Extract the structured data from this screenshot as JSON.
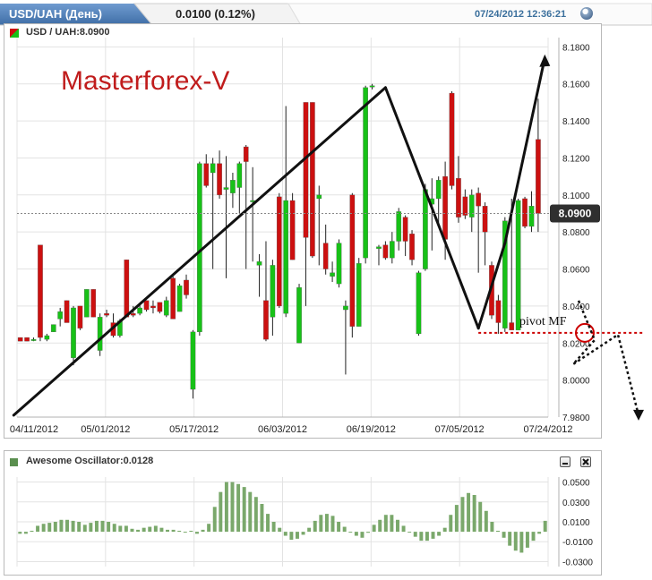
{
  "header": {
    "title": "USD/UAH (День)",
    "change": "0.0100 (0.12%)",
    "timestamp": "07/24/2012 12:36:21"
  },
  "price_panel": {
    "label": "USD / UAH:8.0900",
    "watermark": "Masterforex-V",
    "current_value": "8.0900",
    "annotation": "pivot MF"
  },
  "oscillator_panel": {
    "label": "Awesome Oscillator:0.0128"
  },
  "colors": {
    "up": "#17c117",
    "down": "#cc1010",
    "oscillator": "#7aa86b",
    "pivot": "#cc0000",
    "header_tab": "#4f7fb5",
    "timestamp": "#3a6f9c"
  },
  "chart_data": [
    {
      "type": "candlestick",
      "title": "USD / UAH:8.0900",
      "x_ticks": [
        "04/11/2012",
        "05/01/2012",
        "05/17/2012",
        "06/03/2012",
        "06/19/2012",
        "07/05/2012",
        "07/24/2012"
      ],
      "y_ticks": [
        "8.1800",
        "8.1600",
        "8.1400",
        "8.1200",
        "8.1000",
        "8.0800",
        "8.0600",
        "8.0400",
        "8.0200",
        "8.0000",
        "7.9800"
      ],
      "ylim": [
        7.98,
        8.185
      ],
      "last_value": 8.09,
      "candles": [
        {
          "x": 0,
          "o": 8.023,
          "h": 8.023,
          "l": 8.021,
          "c": 8.021
        },
        {
          "x": 1,
          "o": 8.023,
          "h": 8.023,
          "l": 8.021,
          "c": 8.021
        },
        {
          "x": 2,
          "o": 8.022,
          "h": 8.023,
          "l": 8.021,
          "c": 8.022
        },
        {
          "x": 3,
          "o": 8.073,
          "h": 8.073,
          "l": 8.021,
          "c": 8.023
        },
        {
          "x": 4,
          "o": 8.022,
          "h": 8.025,
          "l": 8.021,
          "c": 8.024
        },
        {
          "x": 5,
          "o": 8.026,
          "h": 8.03,
          "l": 8.026,
          "c": 8.03
        },
        {
          "x": 6,
          "o": 8.033,
          "h": 8.039,
          "l": 8.029,
          "c": 8.037
        },
        {
          "x": 7,
          "o": 8.043,
          "h": 8.043,
          "l": 8.031,
          "c": 8.031
        },
        {
          "x": 8,
          "o": 8.012,
          "h": 8.04,
          "l": 8.008,
          "c": 8.039
        },
        {
          "x": 9,
          "o": 8.04,
          "h": 8.04,
          "l": 8.027,
          "c": 8.028
        },
        {
          "x": 10,
          "o": 8.034,
          "h": 8.049,
          "l": 8.034,
          "c": 8.049
        },
        {
          "x": 11,
          "o": 8.049,
          "h": 8.049,
          "l": 8.034,
          "c": 8.034
        },
        {
          "x": 12,
          "o": 8.016,
          "h": 8.036,
          "l": 8.013,
          "c": 8.034
        },
        {
          "x": 13,
          "o": 8.036,
          "h": 8.038,
          "l": 8.034,
          "c": 8.035
        },
        {
          "x": 14,
          "o": 8.031,
          "h": 8.036,
          "l": 8.023,
          "c": 8.024
        },
        {
          "x": 15,
          "o": 8.024,
          "h": 8.033,
          "l": 8.023,
          "c": 8.032
        },
        {
          "x": 16,
          "o": 8.065,
          "h": 8.065,
          "l": 8.034,
          "c": 8.034
        },
        {
          "x": 17,
          "o": 8.036,
          "h": 8.04,
          "l": 8.034,
          "c": 8.035
        },
        {
          "x": 18,
          "o": 8.036,
          "h": 8.041,
          "l": 8.035,
          "c": 8.039
        },
        {
          "x": 19,
          "o": 8.043,
          "h": 8.043,
          "l": 8.037,
          "c": 8.038
        },
        {
          "x": 20,
          "o": 8.04,
          "h": 8.043,
          "l": 8.036,
          "c": 8.039
        },
        {
          "x": 21,
          "o": 8.042,
          "h": 8.042,
          "l": 8.036,
          "c": 8.037
        },
        {
          "x": 22,
          "o": 8.035,
          "h": 8.045,
          "l": 8.034,
          "c": 8.043
        },
        {
          "x": 23,
          "o": 8.055,
          "h": 8.056,
          "l": 8.033,
          "c": 8.033
        },
        {
          "x": 24,
          "o": 8.037,
          "h": 8.052,
          "l": 8.037,
          "c": 8.051
        },
        {
          "x": 25,
          "o": 8.054,
          "h": 8.057,
          "l": 8.044,
          "c": 8.046
        },
        {
          "x": 26,
          "o": 7.995,
          "h": 8.027,
          "l": 7.99,
          "c": 8.026
        },
        {
          "x": 27,
          "o": 8.026,
          "h": 8.118,
          "l": 8.024,
          "c": 8.117
        },
        {
          "x": 28,
          "o": 8.117,
          "h": 8.122,
          "l": 8.104,
          "c": 8.105
        },
        {
          "x": 29,
          "o": 8.112,
          "h": 8.12,
          "l": 8.06,
          "c": 8.117
        },
        {
          "x": 30,
          "o": 8.117,
          "h": 8.124,
          "l": 8.098,
          "c": 8.1
        },
        {
          "x": 31,
          "o": 8.103,
          "h": 8.121,
          "l": 8.055,
          "c": 8.104
        },
        {
          "x": 32,
          "o": 8.101,
          "h": 8.112,
          "l": 8.093,
          "c": 8.108
        },
        {
          "x": 33,
          "o": 8.104,
          "h": 8.118,
          "l": 8.09,
          "c": 8.117
        },
        {
          "x": 34,
          "o": 8.126,
          "h": 8.127,
          "l": 8.06,
          "c": 8.118
        },
        {
          "x": 35,
          "o": 8.097,
          "h": 8.115,
          "l": 8.064,
          "c": 8.097
        },
        {
          "x": 36,
          "o": 8.062,
          "h": 8.068,
          "l": 8.045,
          "c": 8.064
        },
        {
          "x": 37,
          "o": 8.043,
          "h": 8.075,
          "l": 8.021,
          "c": 8.022
        },
        {
          "x": 38,
          "o": 8.034,
          "h": 8.065,
          "l": 8.024,
          "c": 8.062
        },
        {
          "x": 39,
          "o": 8.099,
          "h": 8.101,
          "l": 8.039,
          "c": 8.04
        },
        {
          "x": 40,
          "o": 8.036,
          "h": 8.148,
          "l": 8.034,
          "c": 8.097
        },
        {
          "x": 41,
          "o": 8.097,
          "h": 8.101,
          "l": 8.065,
          "c": 8.065
        },
        {
          "x": 42,
          "o": 8.02,
          "h": 8.052,
          "l": 8.02,
          "c": 8.05
        },
        {
          "x": 43,
          "o": 8.15,
          "h": 8.15,
          "l": 8.04,
          "c": 8.077
        },
        {
          "x": 44,
          "o": 8.15,
          "h": 8.15,
          "l": 8.066,
          "c": 8.067
        },
        {
          "x": 45,
          "o": 8.098,
          "h": 8.105,
          "l": 8.062,
          "c": 8.1
        },
        {
          "x": 46,
          "o": 8.074,
          "h": 8.084,
          "l": 8.057,
          "c": 8.06
        },
        {
          "x": 47,
          "o": 8.056,
          "h": 8.064,
          "l": 8.053,
          "c": 8.058
        },
        {
          "x": 48,
          "o": 8.052,
          "h": 8.076,
          "l": 8.05,
          "c": 8.074
        },
        {
          "x": 49,
          "o": 8.038,
          "h": 8.043,
          "l": 8.003,
          "c": 8.04
        },
        {
          "x": 50,
          "o": 8.1,
          "h": 8.101,
          "l": 8.023,
          "c": 8.029
        },
        {
          "x": 51,
          "o": 8.029,
          "h": 8.066,
          "l": 8.029,
          "c": 8.063
        },
        {
          "x": 52,
          "o": 8.066,
          "h": 8.159,
          "l": 8.063,
          "c": 8.158
        },
        {
          "x": 53,
          "o": 8.159,
          "h": 8.16,
          "l": 8.157,
          "c": 8.159
        },
        {
          "x": 54,
          "o": 8.071,
          "h": 8.073,
          "l": 8.062,
          "c": 8.072
        },
        {
          "x": 55,
          "o": 8.073,
          "h": 8.075,
          "l": 8.065,
          "c": 8.066
        },
        {
          "x": 56,
          "o": 8.066,
          "h": 8.08,
          "l": 8.063,
          "c": 8.075
        },
        {
          "x": 57,
          "o": 8.075,
          "h": 8.093,
          "l": 8.07,
          "c": 8.091
        },
        {
          "x": 58,
          "o": 8.088,
          "h": 8.089,
          "l": 8.067,
          "c": 8.075
        },
        {
          "x": 59,
          "o": 8.079,
          "h": 8.081,
          "l": 8.062,
          "c": 8.065
        },
        {
          "x": 60,
          "o": 8.025,
          "h": 8.059,
          "l": 8.024,
          "c": 8.058
        },
        {
          "x": 61,
          "o": 8.06,
          "h": 8.106,
          "l": 8.059,
          "c": 8.103
        },
        {
          "x": 62,
          "o": 8.095,
          "h": 8.109,
          "l": 8.07,
          "c": 8.098
        },
        {
          "x": 63,
          "o": 8.098,
          "h": 8.11,
          "l": 8.085,
          "c": 8.108
        },
        {
          "x": 64,
          "o": 8.11,
          "h": 8.118,
          "l": 8.065,
          "c": 8.076
        },
        {
          "x": 65,
          "o": 8.155,
          "h": 8.156,
          "l": 8.103,
          "c": 8.105
        },
        {
          "x": 66,
          "o": 8.109,
          "h": 8.121,
          "l": 8.085,
          "c": 8.088
        },
        {
          "x": 67,
          "o": 8.099,
          "h": 8.103,
          "l": 8.087,
          "c": 8.089
        },
        {
          "x": 68,
          "o": 8.088,
          "h": 8.103,
          "l": 8.08,
          "c": 8.1
        },
        {
          "x": 69,
          "o": 8.101,
          "h": 8.104,
          "l": 8.058,
          "c": 8.094
        },
        {
          "x": 70,
          "o": 8.094,
          "h": 8.096,
          "l": 8.062,
          "c": 8.08
        },
        {
          "x": 71,
          "o": 8.062,
          "h": 8.064,
          "l": 8.033,
          "c": 8.035
        },
        {
          "x": 72,
          "o": 8.043,
          "h": 8.046,
          "l": 8.025,
          "c": 8.031
        },
        {
          "x": 73,
          "o": 8.028,
          "h": 8.088,
          "l": 8.026,
          "c": 8.086
        },
        {
          "x": 74,
          "o": 8.031,
          "h": 8.098,
          "l": 8.027,
          "c": 8.027
        },
        {
          "x": 75,
          "o": 8.027,
          "h": 8.098,
          "l": 8.027,
          "c": 8.097
        },
        {
          "x": 76,
          "o": 8.098,
          "h": 8.099,
          "l": 8.082,
          "c": 8.083
        },
        {
          "x": 77,
          "o": 8.083,
          "h": 8.102,
          "l": 8.08,
          "c": 8.094
        },
        {
          "x": 78,
          "o": 8.13,
          "h": 8.152,
          "l": 8.08,
          "c": 8.09
        }
      ],
      "trend_lines": [
        {
          "from": {
            "x": -1,
            "y": 7.981
          },
          "to": {
            "x": 55,
            "y": 8.158
          }
        },
        {
          "from": {
            "x": 55,
            "y": 8.158
          },
          "to": {
            "x": 69,
            "y": 8.028
          }
        },
        {
          "from": {
            "x": 69,
            "y": 8.028
          },
          "to": {
            "x": 73,
            "y": 8.074
          }
        },
        {
          "from": {
            "x": 73,
            "y": 8.074
          },
          "to": {
            "x": 79,
            "y": 8.174
          }
        }
      ],
      "pivot_level": 8.0255
    },
    {
      "type": "bar",
      "title": "Awesome Oscillator:0.0128",
      "y_ticks": [
        "0.0500",
        "0.0300",
        "0.0100",
        "-0.0100",
        "-0.0300"
      ],
      "ylim": [
        -0.035,
        0.055
      ],
      "values": [
        -0.002,
        -0.002,
        0.001,
        0.006,
        0.008,
        0.009,
        0.01,
        0.012,
        0.012,
        0.011,
        0.01,
        0.007,
        0.009,
        0.011,
        0.011,
        0.01,
        0.008,
        0.006,
        0.006,
        0.003,
        0.002,
        0.004,
        0.005,
        0.006,
        0.004,
        0.002,
        0.002,
        0.001,
        0.0,
        0.001,
        -0.002,
        0.002,
        0.008,
        0.025,
        0.04,
        0.05,
        0.05,
        0.048,
        0.045,
        0.04,
        0.035,
        0.028,
        0.018,
        0.01,
        0.004,
        -0.004,
        -0.008,
        -0.007,
        -0.003,
        0.004,
        0.011,
        0.017,
        0.018,
        0.016,
        0.01,
        0.005,
        0.0,
        -0.004,
        -0.006,
        -0.001,
        0.007,
        0.012,
        0.017,
        0.017,
        0.012,
        0.006,
        0.0,
        -0.005,
        -0.009,
        -0.009,
        -0.007,
        -0.004,
        0.004,
        0.017,
        0.027,
        0.035,
        0.039,
        0.037,
        0.03,
        0.021,
        0.01,
        0.001,
        -0.006,
        -0.014,
        -0.019,
        -0.021,
        -0.016,
        -0.009,
        -0.002,
        0.011
      ]
    }
  ]
}
